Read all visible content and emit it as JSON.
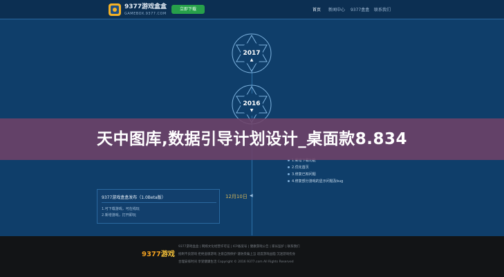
{
  "header": {
    "brand": "9377游戏盒盒",
    "brand_sub": "GAMEBOX.9377.COM",
    "download": "立即下载",
    "nav": [
      "首页",
      "新闻中心",
      "9377盒盒",
      "联系我们"
    ]
  },
  "timeline": {
    "years": [
      {
        "year": "2017",
        "arrow": "▲"
      },
      {
        "year": "2016",
        "arrow": "▼"
      }
    ],
    "notes": [
      "1.新增下载功能",
      "2.优化首页",
      "3.修复已知问题",
      "4.修复部分游戏的显示问题及bug"
    ]
  },
  "banner": {
    "title": "天中图库,数据引导计划设计_桌面款8.834"
  },
  "card": {
    "title": "9377游戏盒盒发布（1.0Beta版）",
    "lines": [
      "1.可下载游戏，可在线玩",
      "2.新增游戏，打开即玩"
    ]
  },
  "date_label": "12月10日",
  "date_arrow": "◀",
  "footer": {
    "logo_main": "9377",
    "logo_k": "游戏",
    "lines": [
      "9377游戏盒盒 | 网络文化经营许可证 | ICP备案号 | 健康游戏公告 | 家长监护 | 联系我们",
      "抵制不良游戏 拒绝盗版游戏 注意自我保护 谨防受骗上当 适度游戏益脑 沉迷游戏伤身",
      "合理安排时间 享受健康生活 Copyright © 2016 9377.com All Rights Reserved"
    ]
  },
  "colors": {
    "background": "#0f3e6a",
    "header": "#0c2f52",
    "banner": "#704268",
    "download_button": "#27a04a",
    "footer": "#121416",
    "date_accent": "#d6b85a"
  }
}
